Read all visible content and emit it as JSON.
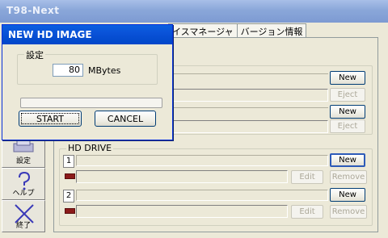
{
  "window": {
    "title": "T98-Next"
  },
  "tabs": [
    {
      "label": "イスマネージャ"
    },
    {
      "label": "バージョン情報"
    }
  ],
  "toolbar": {
    "settings_label": "設定",
    "help_label": "ヘルプ",
    "exit_label": "終了"
  },
  "fd_panel": {
    "new_label": "New",
    "eject_label": "Eject"
  },
  "hd_panel": {
    "title": "HD DRIVE",
    "drives": [
      {
        "number": "1",
        "new_label": "New",
        "edit_label": "Edit",
        "remove_label": "Remove"
      },
      {
        "number": "2",
        "new_label": "New",
        "edit_label": "Edit",
        "remove_label": "Remove"
      }
    ]
  },
  "dialog": {
    "title": "NEW HD IMAGE",
    "group_label": "設定",
    "size_value": "80",
    "unit": "MBytes",
    "progress": 0,
    "start_label": "START",
    "cancel_label": "CANCEL"
  }
}
